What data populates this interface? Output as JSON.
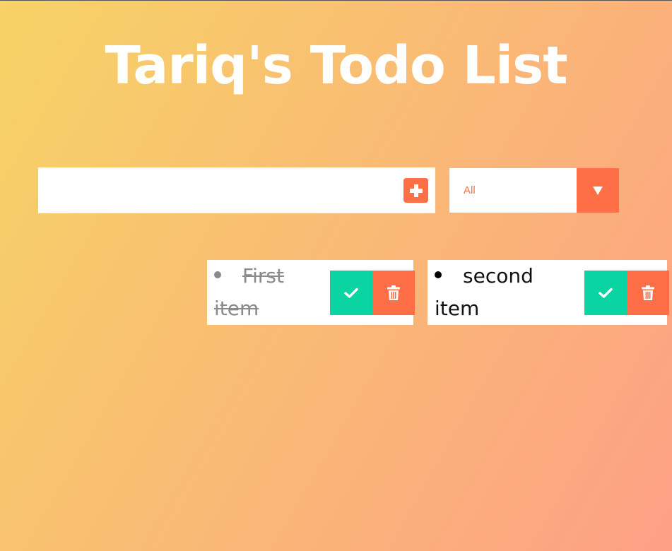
{
  "header": {
    "title": "Tariq's Todo List"
  },
  "form": {
    "input_value": "",
    "add_icon": "plus-square-icon",
    "filter_selected": "All",
    "filter_options": [
      "All"
    ],
    "filter_icon": "caret-down-icon"
  },
  "todos": [
    {
      "text": "First item",
      "completed": true
    },
    {
      "text": "second item",
      "completed": false
    }
  ],
  "colors": {
    "background_start": "#f6d365",
    "background_end": "#fda085",
    "accent": "#ff6f47",
    "complete": "#0bd4a3",
    "completed_text": "#8a8a8a"
  },
  "icons": {
    "complete": "check-icon",
    "delete": "trash-icon"
  }
}
